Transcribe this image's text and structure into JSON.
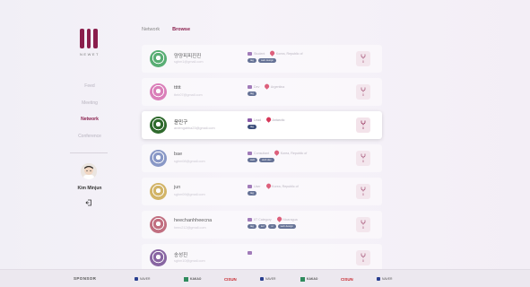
{
  "sidebar": {
    "brand": "NEWET",
    "nav": [
      {
        "label": "Feed",
        "active": false
      },
      {
        "label": "Meeting",
        "active": false
      },
      {
        "label": "Network",
        "active": true
      },
      {
        "label": "Conference",
        "active": false
      }
    ],
    "user_name": "Kim Minjun"
  },
  "tabs": [
    {
      "label": "Network",
      "active": false
    },
    {
      "label": "Browse",
      "active": true
    }
  ],
  "people": [
    {
      "name": "양양피피진진",
      "email": "sghm1@gmail.com",
      "job": "Student",
      "location": "Korea, Republic of",
      "tags": [
        "tag",
        "web design"
      ],
      "likes": "0",
      "avatar_color": "#2e9b50",
      "state": "dim"
    },
    {
      "name": "ttttt",
      "email": "tteb07@gmail.com",
      "job": "Dev",
      "location": "Argentina",
      "tags": [
        "tag"
      ],
      "likes": "0",
      "avatar_color": "#d35fa8",
      "state": "dim"
    },
    {
      "name": "윤민구",
      "email": "ardengabba23@gmail.com",
      "job": "Lead",
      "location": "Antarctic",
      "tags": [
        "tag"
      ],
      "likes": "0",
      "avatar_color": "#2f6a2d",
      "state": "focused"
    },
    {
      "name": "bae",
      "email": "sghm08@gmail.com",
      "job": "Consultant",
      "location": "Korea, Republic of",
      "tags": [
        "web",
        "web dev"
      ],
      "likes": "0",
      "avatar_color": "#6c7fb8",
      "state": "dim"
    },
    {
      "name": "jun",
      "email": "sghm09@gmail.com",
      "job": "User",
      "location": "Korea, Republic of",
      "tags": [
        "tag"
      ],
      "likes": "0",
      "avatar_color": "#c9a33f",
      "state": "dim"
    },
    {
      "name": "heechanhheecna",
      "email": "heec212@gmail.com",
      "job": "IIT Category",
      "location": "Nicaragua",
      "tags": [
        "tag",
        "sel",
        "ui",
        "web design"
      ],
      "likes": "0",
      "avatar_color": "#b34b5f",
      "state": "dim"
    },
    {
      "name": "송성진",
      "email": "sghm10@gmail.com",
      "job": "",
      "location": "",
      "tags": [],
      "likes": "0",
      "avatar_color": "#6b3f8b",
      "state": "dim"
    }
  ],
  "footer": {
    "label": "SPONSOR",
    "sponsors": [
      "NAVER",
      "KAKAO",
      "CISUN",
      "NAVER",
      "KAKAO",
      "CISUN",
      "NAVER"
    ]
  },
  "colors": {
    "brand": "#8a1e4c",
    "tag": "#3d4f7b",
    "pin": "#d6385a",
    "case": "#8a5aa8"
  }
}
